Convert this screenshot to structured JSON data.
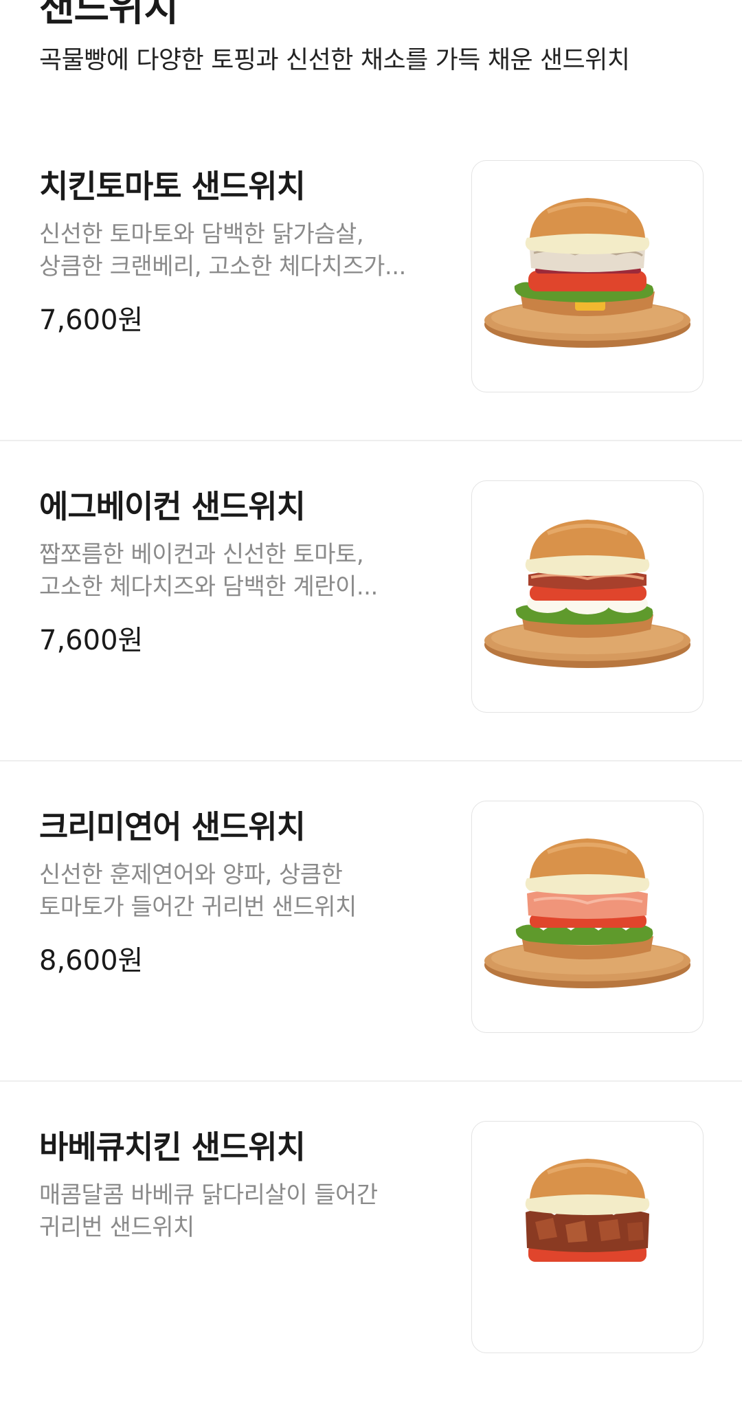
{
  "section": {
    "title": "샌드위치",
    "description": "곡물빵에 다양한 토핑과 신선한 채소를 가득 채운 샌드위치"
  },
  "items": [
    {
      "name": "치킨토마토 샌드위치",
      "desc_line1": "신선한 토마토와 담백한 닭가슴살,",
      "desc_line2": "상큼한 크랜베리, 고소한 체다치즈가...",
      "price": "7,600원",
      "image_icon": "chicken-tomato-sandwich-image"
    },
    {
      "name": "에그베이컨 샌드위치",
      "desc_line1": "짭쪼름한 베이컨과 신선한 토마토,",
      "desc_line2": "고소한 체다치즈와 담백한 계란이...",
      "price": "7,600원",
      "image_icon": "egg-bacon-sandwich-image"
    },
    {
      "name": "크리미연어 샌드위치",
      "desc_line1": "신선한 훈제연어와 양파, 상큼한",
      "desc_line2": "토마토가 들어간 귀리번 샌드위치",
      "price": "8,600원",
      "image_icon": "creamy-salmon-sandwich-image"
    },
    {
      "name": "바베큐치킨 샌드위치",
      "desc_line1": "매콤달콤 바베큐 닭다리살이 들어간",
      "desc_line2": "귀리번 샌드위치",
      "price": "",
      "image_icon": "bbq-chicken-sandwich-image"
    }
  ],
  "colors": {
    "text_primary": "#1a1a1a",
    "text_secondary": "#8a8a8a",
    "divider": "#eeeeee",
    "thumb_border": "#e3e3e3",
    "bun": "#d9924a",
    "board": "#c98a4e",
    "lettuce": "#6aa532",
    "tomato": "#e0452c",
    "cheese_sauce": "#f3ecc8"
  }
}
